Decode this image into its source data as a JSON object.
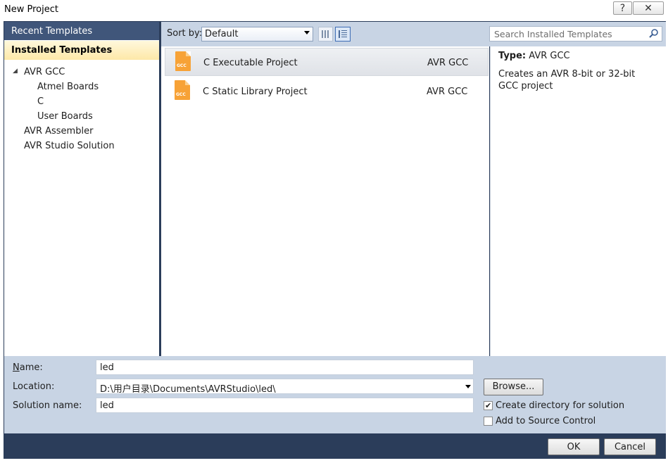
{
  "window": {
    "title": "New Project",
    "help_label": "?",
    "close_label": "✕"
  },
  "left": {
    "recent_header": "Recent Templates",
    "installed_header": "Installed Templates",
    "tree": [
      {
        "label": "AVR GCC",
        "expanded": true
      },
      {
        "label": "Atmel Boards"
      },
      {
        "label": "C"
      },
      {
        "label": "User Boards"
      },
      {
        "label": "AVR Assembler"
      },
      {
        "label": "AVR Studio Solution"
      }
    ]
  },
  "toolbar": {
    "sort_label": "Sort by:",
    "sort_value": "Default",
    "search_placeholder": "Search Installed Templates"
  },
  "templates": [
    {
      "name": "C Executable Project",
      "lang": "AVR GCC",
      "icon_text": "GCC",
      "selected": true
    },
    {
      "name": "C Static Library Project",
      "lang": "AVR GCC",
      "icon_text": "GCC",
      "selected": false
    }
  ],
  "details": {
    "type_label": "Type:",
    "type_value": "AVR GCC",
    "description": "Creates an AVR 8-bit or 32-bit GCC project"
  },
  "form": {
    "name_label": "Name:",
    "name_value": "led",
    "location_label": "Location:",
    "location_value": "D:\\用户目录\\Documents\\AVRStudio\\led\\",
    "solution_label": "Solution name:",
    "solution_value": "led",
    "browse_label": "Browse...",
    "create_dir_label": "Create directory for solution",
    "create_dir_checked": true,
    "source_control_label": "Add to Source Control",
    "source_control_checked": false
  },
  "buttons": {
    "ok": "OK",
    "cancel": "Cancel"
  },
  "colors": {
    "frame": "#2b3d5a",
    "header_blue": "#40567a",
    "toolbar": "#c8d4e4",
    "selected_header": "#fde8a8",
    "template_icon": "#f7a236"
  }
}
